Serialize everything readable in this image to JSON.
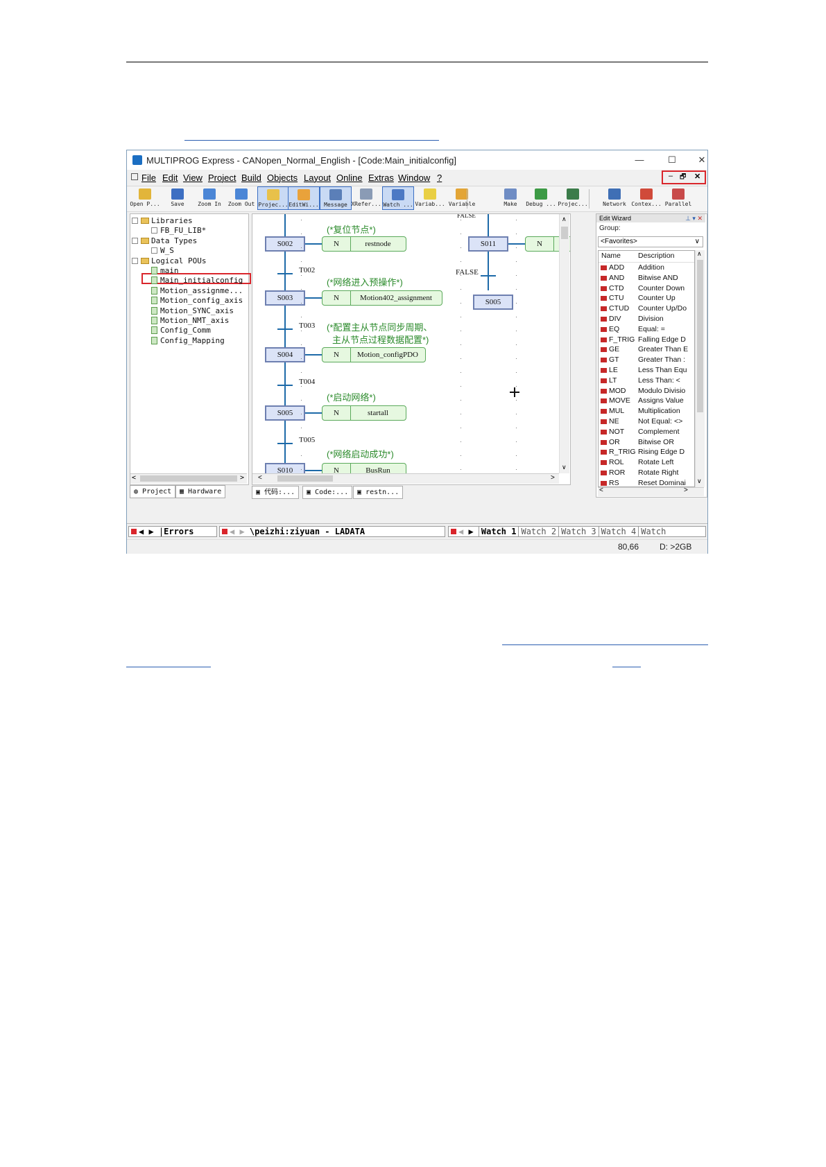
{
  "window": {
    "title": "MULTIPROG Express - CANopen_Normal_English - [Code:Main_initialconfig]",
    "controls": {
      "minimize": "—",
      "maximize": "☐",
      "close": "✕",
      "child_min": "–",
      "child_restore": "🗗",
      "child_close": "✕"
    }
  },
  "menu": [
    "File",
    "Edit",
    "View",
    "Project",
    "Build",
    "Objects",
    "Layout",
    "Online",
    "Extras",
    "Window",
    "?"
  ],
  "toolbar": [
    {
      "label": "Open P...",
      "icon": "open-folder-icon",
      "color": "#e2b53a"
    },
    {
      "label": "Save",
      "icon": "save-icon",
      "color": "#3d6fc2"
    },
    {
      "label": "Zoom In",
      "icon": "zoom-in-icon",
      "color": "#4b86d6"
    },
    {
      "label": "Zoom Out",
      "icon": "zoom-out-icon",
      "color": "#4b86d6"
    },
    {
      "label": "Projec...",
      "icon": "project-tree-icon",
      "color": "#e8c14a"
    },
    {
      "label": "EditWi...",
      "icon": "edit-wizard-icon",
      "color": "#e9a23b"
    },
    {
      "label": "Message",
      "icon": "message-window-icon",
      "color": "#5b7fb8"
    },
    {
      "label": "XRefer...",
      "icon": "cross-reference-icon",
      "color": "#8a9bb5"
    },
    {
      "label": "Watch ...",
      "icon": "watch-window-icon",
      "color": "#4c79c4"
    },
    {
      "label": "Variab...",
      "icon": "variables-icon",
      "color": "#e9cf44"
    },
    {
      "label": "Variable",
      "icon": "variable-icon",
      "color": "#e3a536"
    },
    {
      "label": "Make",
      "icon": "make-icon",
      "color": "#6f8dc4"
    },
    {
      "label": "Debug ...",
      "icon": "debug-icon",
      "color": "#3c9a45"
    },
    {
      "label": "Projec...",
      "icon": "project-control-icon",
      "color": "#3b7c4a"
    },
    {
      "label": "Network",
      "icon": "network-icon",
      "color": "#3f6fb5"
    },
    {
      "label": "Contex...",
      "icon": "context-icon",
      "color": "#d04a3a"
    },
    {
      "label": "Parallel",
      "icon": "parallel-icon",
      "color": "#c84a4a"
    }
  ],
  "tree": [
    {
      "label": "Libraries",
      "level": 0,
      "kind": "folder"
    },
    {
      "label": "FB_FU_LIB*",
      "level": 1,
      "kind": "lib"
    },
    {
      "label": "Data Types",
      "level": 0,
      "kind": "folder"
    },
    {
      "label": "W_S",
      "level": 1,
      "kind": "type"
    },
    {
      "label": "Logical POUs",
      "level": 0,
      "kind": "folder"
    },
    {
      "label": "main",
      "level": 1,
      "kind": "pou"
    },
    {
      "label": "Main_initialconfig",
      "level": 1,
      "kind": "pou",
      "highlight": true
    },
    {
      "label": "Motion_assignme...",
      "level": 1,
      "kind": "pou"
    },
    {
      "label": "Motion_config_axis",
      "level": 1,
      "kind": "pou"
    },
    {
      "label": "Motion_SYNC_axis",
      "level": 1,
      "kind": "pou"
    },
    {
      "label": "Motion_NMT_axis",
      "level": 1,
      "kind": "pou"
    },
    {
      "label": "Config_Comm",
      "level": 1,
      "kind": "pou"
    },
    {
      "label": "Config_Mapping",
      "level": 1,
      "kind": "pou"
    }
  ],
  "left_tabs": [
    "Project",
    "Hardware"
  ],
  "editor_tabs": [
    "代码:...",
    "Code:...",
    "restn..."
  ],
  "sfc": {
    "top_label": "FALSE",
    "steps": [
      {
        "name": "S002",
        "qualifier": "N",
        "action": "restnode",
        "comment": "(*复位节点*)"
      },
      {
        "name": "S003",
        "qualifier": "N",
        "action": "Motion402_assignment",
        "comment": "(*网络进入预操作*)"
      },
      {
        "name": "S004",
        "qualifier": "N",
        "action": "Motion_configPDO",
        "comment": "(*配置主从节点同步周期、",
        "comment2": "主从节点过程数据配置*)"
      },
      {
        "name": "S005",
        "qualifier": "N",
        "action": "startall",
        "comment": "(*启动网络*)"
      },
      {
        "name": "S010",
        "qualifier": "N",
        "action": "BusRun",
        "comment": "(*网络启动成功*)"
      }
    ],
    "transitions": [
      "T002",
      "T003",
      "T004",
      "T005"
    ],
    "branch": {
      "step1": "S011",
      "qualifier": "N",
      "label": "FALSE",
      "step2": "S005"
    }
  },
  "edit_wizard": {
    "title": "Edit Wizard",
    "group_label": "Group:",
    "group_value": "<Favorites>",
    "columns": [
      "Name",
      "Description"
    ],
    "rows": [
      [
        "ADD",
        "Addition"
      ],
      [
        "AND",
        "Bitwise AND"
      ],
      [
        "CTD",
        "Counter Down"
      ],
      [
        "CTU",
        "Counter Up"
      ],
      [
        "CTUD",
        "Counter Up/Do"
      ],
      [
        "DIV",
        "Division"
      ],
      [
        "EQ",
        "Equal: ="
      ],
      [
        "F_TRIG",
        "Falling Edge D"
      ],
      [
        "GE",
        "Greater Than E"
      ],
      [
        "GT",
        "Greater Than :"
      ],
      [
        "LE",
        "Less Than Equ"
      ],
      [
        "LT",
        "Less Than: <"
      ],
      [
        "MOD",
        "Modulo Divisio"
      ],
      [
        "MOVE",
        "Assigns Value"
      ],
      [
        "MUL",
        "Multiplication"
      ],
      [
        "NE",
        "Not Equal: <>"
      ],
      [
        "NOT",
        "Complement"
      ],
      [
        "OR",
        "Bitwise OR"
      ],
      [
        "R_TRIG",
        "Rising Edge D"
      ],
      [
        "ROL",
        "Rotate Left"
      ],
      [
        "ROR",
        "Rotate Right"
      ],
      [
        "RS",
        "Reset Dominai"
      ]
    ]
  },
  "bottom": {
    "errors_tab": "Errors",
    "path": "\\peizhi:ziyuan - LADATA",
    "watch_tabs": [
      "Watch 1",
      "Watch 2",
      "Watch 3",
      "Watch 4",
      "Watch"
    ]
  },
  "status": {
    "coords": "80,66",
    "disk": "D: >2GB"
  }
}
